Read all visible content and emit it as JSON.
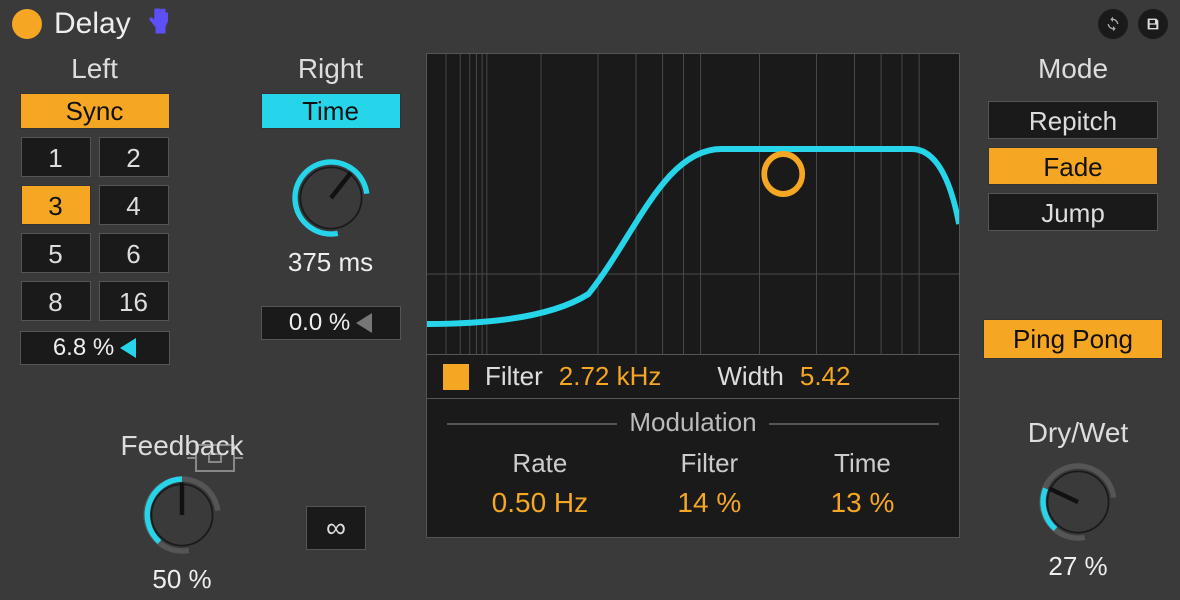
{
  "title": "Delay",
  "colors": {
    "orange": "#f5a623",
    "cyan": "#26d5ea"
  },
  "left": {
    "label": "Left",
    "sync_label": "Sync",
    "divisions": [
      "1",
      "2",
      "3",
      "4",
      "5",
      "6",
      "8",
      "16"
    ],
    "active_division": "3",
    "offset": "6.8 %"
  },
  "right": {
    "label": "Right",
    "time_label": "Time",
    "time_value": "375 ms",
    "offset": "0.0 %"
  },
  "filter": {
    "label": "Filter",
    "freq": "2.72 kHz",
    "width_label": "Width",
    "width": "5.42"
  },
  "modulation": {
    "title": "Modulation",
    "rate_label": "Rate",
    "rate": "0.50 Hz",
    "filter_label": "Filter",
    "filter": "14 %",
    "time_label": "Time",
    "time": "13 %"
  },
  "mode": {
    "label": "Mode",
    "options": [
      "Repitch",
      "Fade",
      "Jump"
    ],
    "active": "Fade",
    "pingpong_label": "Ping Pong"
  },
  "feedback": {
    "label": "Feedback",
    "value": "50 %"
  },
  "drywet": {
    "label": "Dry/Wet",
    "value": "27 %"
  }
}
